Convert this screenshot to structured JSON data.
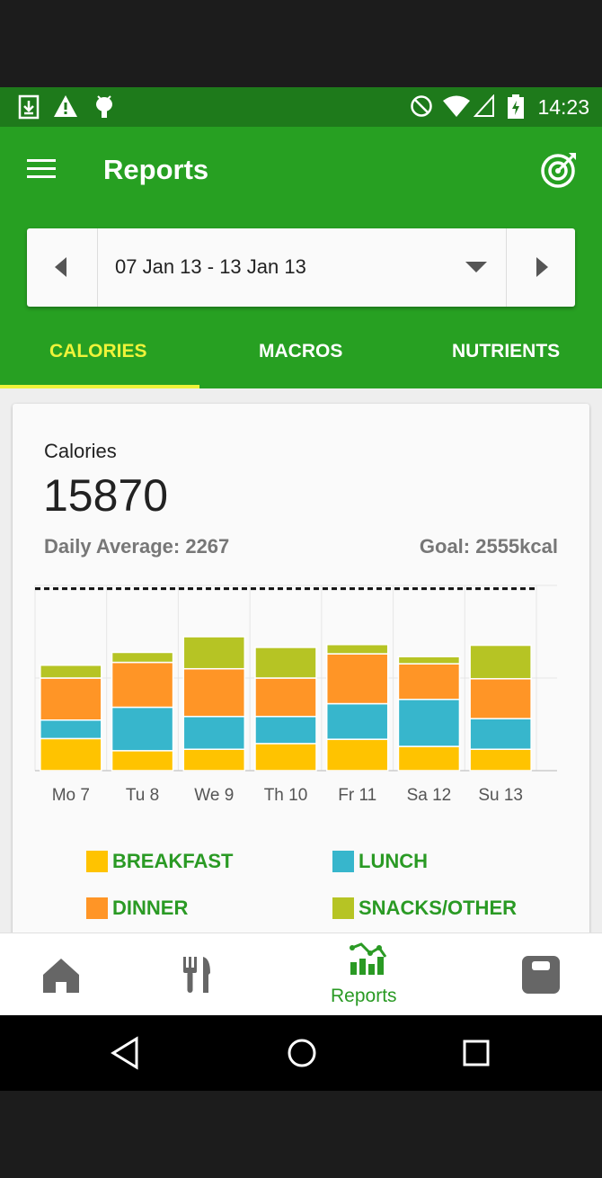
{
  "status_bar": {
    "time": "14:23",
    "left_icons": [
      "download-icon",
      "warning-icon",
      "android-debug-icon"
    ],
    "right_icons": [
      "do-not-disturb-icon",
      "wifi-icon",
      "cell-signal-icon",
      "battery-charging-icon"
    ]
  },
  "app_bar": {
    "title": "Reports",
    "menu_icon": "menu-icon",
    "goal_icon": "target-icon"
  },
  "date_picker": {
    "range": "07 Jan 13 - 13 Jan 13",
    "prev_icon": "chevron-left-icon",
    "next_icon": "chevron-right-icon",
    "dropdown_icon": "caret-down-icon"
  },
  "tabs": [
    {
      "label": "CALORIES",
      "active": true
    },
    {
      "label": "MACROS",
      "active": false
    },
    {
      "label": "NUTRIENTS",
      "active": false
    }
  ],
  "card": {
    "label": "Calories",
    "total": "15870",
    "daily_average": "Daily Average: 2267",
    "goal": "Goal: 2555kcal"
  },
  "colors": {
    "primary_green": "#27a022",
    "dark_green": "#1e7a1b",
    "accent_yellow": "#eef33a",
    "breakfast": "#ffc300",
    "lunch": "#37b6cc",
    "dinner": "#ff9526",
    "snacks": "#b6c424"
  },
  "chart_data": {
    "type": "bar",
    "stacked": true,
    "categories": [
      "Mo 7",
      "Tu 8",
      "We 9",
      "Th 10",
      "Fr 11",
      "Sa 12",
      "Su 13"
    ],
    "series": [
      {
        "name": "BREAKFAST",
        "values": [
          450,
          280,
          300,
          380,
          440,
          340,
          300
        ]
      },
      {
        "name": "LUNCH",
        "values": [
          260,
          610,
          460,
          380,
          500,
          660,
          430
        ]
      },
      {
        "name": "DINNER",
        "values": [
          590,
          630,
          670,
          540,
          700,
          500,
          560
        ]
      },
      {
        "name": "SNACKS/OTHER",
        "values": [
          180,
          140,
          450,
          430,
          130,
          100,
          470
        ]
      }
    ],
    "goal_line": 2555,
    "ylim": [
      0,
      2600
    ],
    "grid": true
  },
  "legend": [
    {
      "label": "BREAKFAST"
    },
    {
      "label": "LUNCH"
    },
    {
      "label": "DINNER"
    },
    {
      "label": "SNACKS/OTHER"
    }
  ],
  "bottom_nav": [
    {
      "icon": "home-icon",
      "label": ""
    },
    {
      "icon": "fork-knife-icon",
      "label": ""
    },
    {
      "icon": "reports-chart-icon",
      "label": "Reports"
    },
    {
      "icon": "scale-icon",
      "label": ""
    }
  ],
  "system_nav": [
    "back-icon",
    "home-circle-icon",
    "recents-icon"
  ]
}
